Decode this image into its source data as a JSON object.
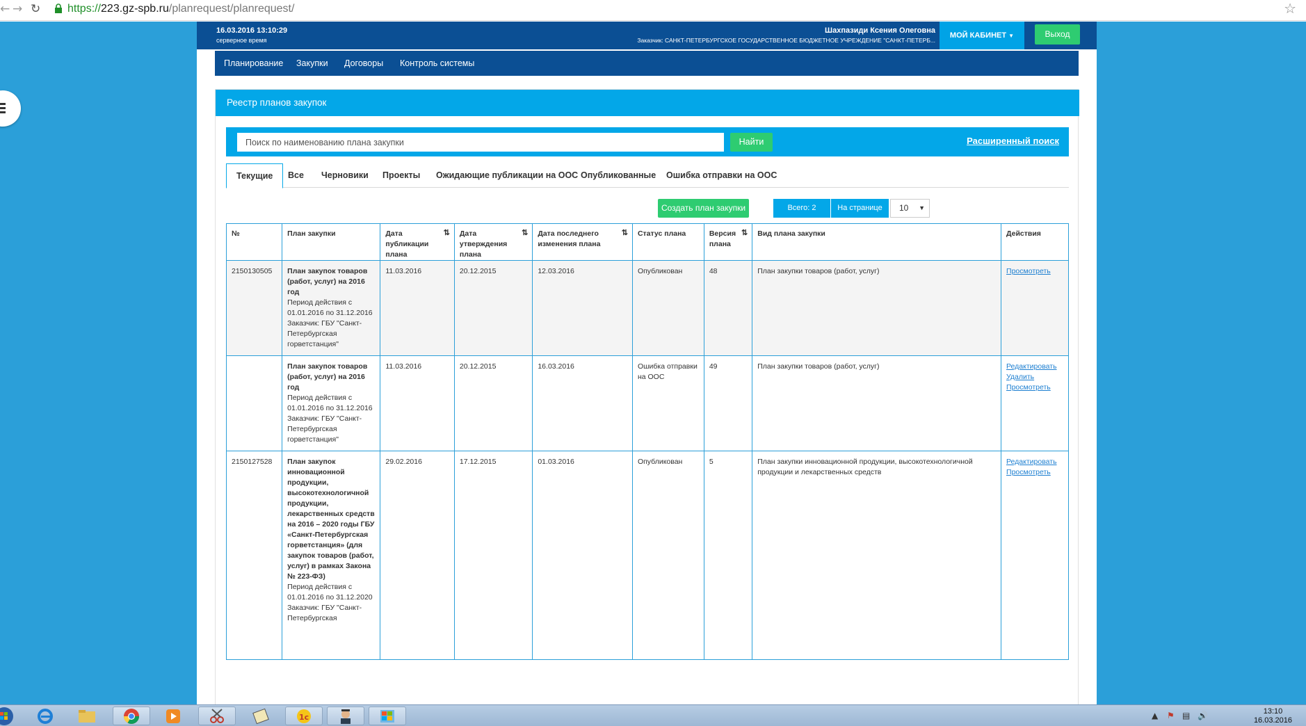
{
  "browser": {
    "url_scheme": "https://",
    "url_host": "223.gz-spb.ru",
    "url_path": "/planrequest/planrequest/"
  },
  "header": {
    "datetime": "16.03.2016 13:10:29",
    "server_time_label": "серверное время",
    "user_name": "Шахпазиди Ксения Олеговна",
    "customer": "Заказчик: САНКТ-ПЕТЕРБУРГСКОЕ ГОСУДАРСТВЕННОЕ БЮДЖЕТНОЕ УЧРЕЖДЕНИЕ \"САНКТ-ПЕТЕРБ...",
    "cabinet_label": "МОЙ КАБИНЕТ",
    "exit_label": "Выход"
  },
  "nav": {
    "items": [
      "Планирование",
      "Закупки",
      "Договоры",
      "Контроль системы"
    ]
  },
  "panel": {
    "title": "Реестр планов закупок"
  },
  "search": {
    "placeholder": "Поиск по наименованию плана закупки",
    "button": "Найти",
    "advanced": "Расширенный поиск"
  },
  "tabs": [
    "Текущие",
    "Все",
    "Черновики",
    "Проекты",
    "Ожидающие публикации на ООС",
    "Опубликованные",
    "Ошибка отправки на ООС"
  ],
  "toolbar": {
    "create": "Создать план закупки",
    "total": "Всего: 2",
    "per_page_label": "На странице",
    "per_page_value": "10"
  },
  "table": {
    "headers": {
      "num": "№",
      "plan": "План закупки",
      "pub_date": "Дата публикации плана",
      "appr_date": "Дата утверждения плана",
      "mod_date": "Дата последнего изменения плана",
      "status": "Статус плана",
      "version": "Версия плана",
      "kind": "Вид плана закупки",
      "actions": "Действия"
    },
    "rows": [
      {
        "num": "2150130505",
        "title": "План закупок товаров (работ, услуг) на 2016 год",
        "period": "Период действия с 01.01.2016 по 31.12.2016",
        "customer": "Заказчик: ГБУ \"Санкт-Петербургская горветстанция\"",
        "pub": "11.03.2016",
        "appr": "20.12.2015",
        "mod": "12.03.2016",
        "status": "Опубликован",
        "version": "48",
        "kind": "План закупки товаров (работ, услуг)",
        "actions": [
          "Просмотреть"
        ]
      },
      {
        "num": "",
        "title": "План закупок товаров (работ, услуг) на 2016 год",
        "period": "Период действия с 01.01.2016 по 31.12.2016",
        "customer": "Заказчик: ГБУ \"Санкт-Петербургская горветстанция\"",
        "pub": "11.03.2016",
        "appr": "20.12.2015",
        "mod": "16.03.2016",
        "status": "Ошибка отправки на ООС",
        "version": "49",
        "kind": "План закупки товаров (работ, услуг)",
        "actions": [
          "Редактировать",
          "Удалить",
          "Просмотреть"
        ]
      },
      {
        "num": "2150127528",
        "title": "План закупок инновационной продукции, высокотехнологичной продукции, лекарственных средств на 2016 – 2020 годы ГБУ «Санкт-Петербургская горветстанция» (для закупок товаров (работ, услуг) в рамках Закона № 223-ФЗ)",
        "period": "Период действия с 01.01.2016 по 31.12.2020",
        "customer": "Заказчик: ГБУ \"Санкт-Петербургская",
        "pub": "29.02.2016",
        "appr": "17.12.2015",
        "mod": "01.03.2016",
        "status": "Опубликован",
        "version": "5",
        "kind": "План закупки инновационной продукции, высокотехнологичной продукции и лекарственных средств",
        "actions": [
          "Редактировать",
          "Просмотреть"
        ]
      }
    ]
  },
  "taskbar": {
    "time": "13:10",
    "date": "16.03.2016"
  }
}
